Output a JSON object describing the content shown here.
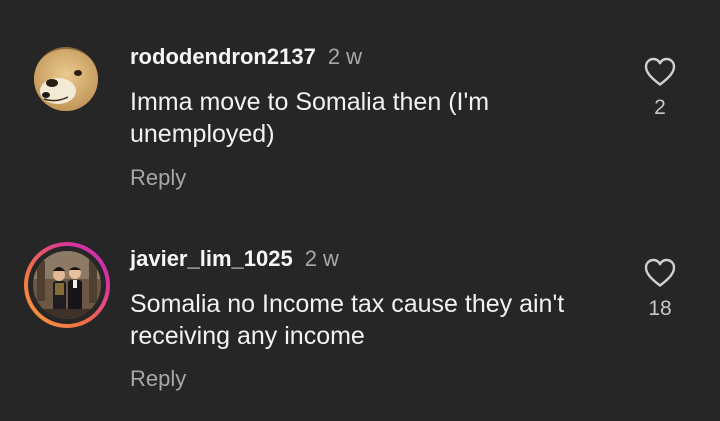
{
  "comments": [
    {
      "username": "rododendron2137",
      "time": "2 w",
      "text": "Imma move to Somalia then (I'm unemployed)",
      "reply_label": "Reply",
      "like_count": "2",
      "avatar": "doge-dog-avatar"
    },
    {
      "username": "javier_lim_1025",
      "time": "2 w",
      "text": "Somalia no Income tax cause they ain't receiving any income",
      "reply_label": "Reply",
      "like_count": "18",
      "avatar": "couple-photo-avatar-with-story-ring"
    }
  ],
  "icons": {
    "like": "heart-outline-icon"
  },
  "colors": {
    "background": "#262626",
    "secondary_text": "#a8a8a8",
    "story_ring_start": "#f9a23a",
    "story_ring_end": "#c026b8"
  }
}
